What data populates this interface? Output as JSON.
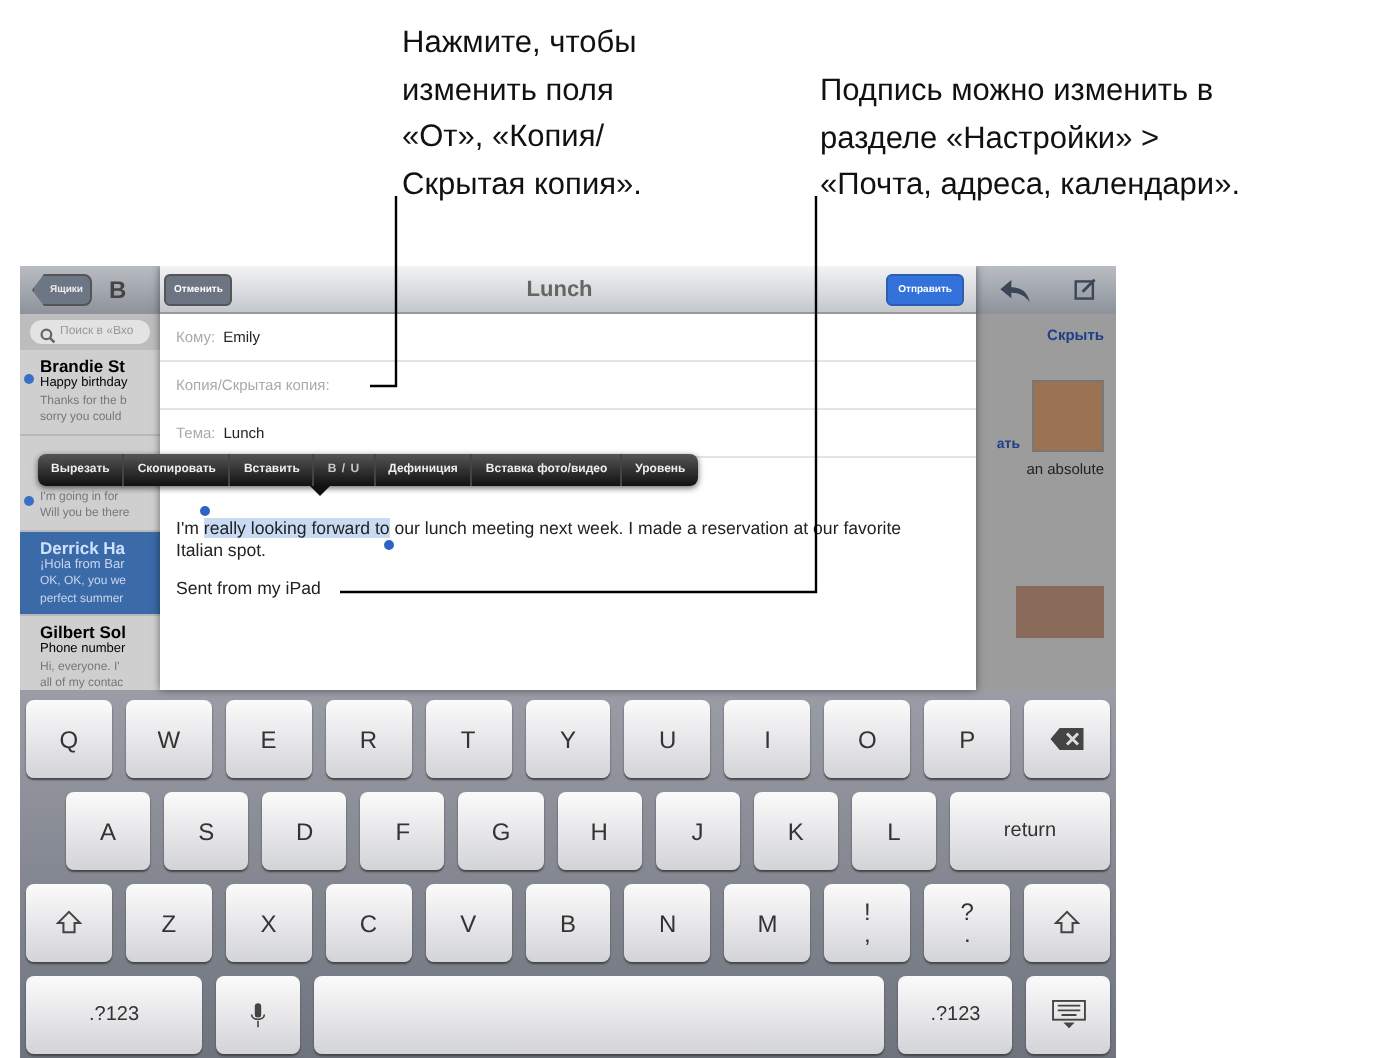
{
  "callouts": [
    {
      "lines": [
        "Нажмите, чтобы",
        "изменить поля",
        "«От», «Копия/",
        "Скрытая копия»."
      ]
    },
    {
      "lines": [
        "Подпись можно изменить в",
        "разделе «Настройки» >",
        "«Почта, адреса, календари»."
      ]
    }
  ],
  "mail_list": {
    "back_button": "Ящики",
    "title": "В",
    "search": {
      "placeholder": "Поиск в «Вхо"
    },
    "items": [
      {
        "sender": "Brandie St",
        "subject": "Happy birthday",
        "preview": [
          "Thanks for the b",
          "sorry you could"
        ],
        "unread": true,
        "selected": false
      },
      {
        "preview": [
          "I'm going in for",
          "Will you be there"
        ],
        "unread": true,
        "selected": false
      },
      {
        "sender": "Derrick Ha",
        "subject": "¡Hola from Bar",
        "preview": [
          "OK, OK, you we",
          "perfect summer"
        ],
        "unread": false,
        "selected": true
      },
      {
        "sender": "Gilbert Sol",
        "subject": "Phone number",
        "preview": [
          "Hi, everyone. I'",
          "all of my contac"
        ],
        "unread": false,
        "selected": false
      }
    ]
  },
  "message_pane": {
    "hide_link": "Скрыть",
    "partial_link": "ать",
    "preview_text": "an absolute"
  },
  "compose": {
    "cancel": "Отменить",
    "title": "Lunch",
    "send": "Отправить",
    "fields": [
      {
        "label": "Кому:",
        "value": "Emily"
      },
      {
        "label": "Копия/Скрытая копия:"
      },
      {
        "label": "Тема:",
        "value": "Lunch"
      }
    ],
    "body": {
      "before": "I'm ",
      "selected": "really looking forward to",
      "after": " our lunch meeting next week. I made a reservation at our favorite Italian spot."
    },
    "signature": "Sent from my iPad"
  },
  "edit_menu": [
    {
      "label": "Вырезать",
      "kind": "text"
    },
    {
      "label": "Скопировать",
      "kind": "text"
    },
    {
      "label": "Вставить",
      "kind": "text"
    },
    {
      "label": "B / U",
      "kind": "format"
    },
    {
      "label": "Дефиниция",
      "kind": "text"
    },
    {
      "label": "Вставка фото/видео",
      "kind": "text"
    },
    {
      "label": "Уровень",
      "kind": "text"
    }
  ],
  "keyboard": [
    [
      {
        "label": "Q",
        "kind": "char"
      },
      {
        "label": "W",
        "kind": "char"
      },
      {
        "label": "E",
        "kind": "char"
      },
      {
        "label": "R",
        "kind": "char"
      },
      {
        "label": "T",
        "kind": "char"
      },
      {
        "label": "Y",
        "kind": "char"
      },
      {
        "label": "U",
        "kind": "char"
      },
      {
        "label": "I",
        "kind": "char"
      },
      {
        "label": "O",
        "kind": "char"
      },
      {
        "label": "P",
        "kind": "char"
      },
      {
        "kind": "backspace"
      }
    ],
    [
      {
        "label": "A",
        "kind": "char"
      },
      {
        "label": "S",
        "kind": "char"
      },
      {
        "label": "D",
        "kind": "char"
      },
      {
        "label": "F",
        "kind": "char"
      },
      {
        "label": "G",
        "kind": "char"
      },
      {
        "label": "H",
        "kind": "char"
      },
      {
        "label": "J",
        "kind": "char"
      },
      {
        "label": "K",
        "kind": "char"
      },
      {
        "label": "L",
        "kind": "char"
      },
      {
        "label": "return",
        "kind": "wide"
      }
    ],
    [
      {
        "kind": "shift"
      },
      {
        "label": "Z",
        "kind": "char"
      },
      {
        "label": "X",
        "kind": "char"
      },
      {
        "label": "C",
        "kind": "char"
      },
      {
        "label": "V",
        "kind": "char"
      },
      {
        "label": "B",
        "kind": "char"
      },
      {
        "label": "N",
        "kind": "char"
      },
      {
        "label": "M",
        "kind": "char"
      },
      {
        "label": "!",
        "sub": ",",
        "kind": "char"
      },
      {
        "label": "?",
        "sub": ".",
        "kind": "char"
      },
      {
        "kind": "shift"
      }
    ],
    [
      {
        "label": ".?123",
        "kind": "wide"
      },
      {
        "kind": "mic"
      },
      {
        "kind": "space"
      },
      {
        "label": ".?123",
        "kind": "wide"
      },
      {
        "kind": "hide"
      }
    ]
  ]
}
